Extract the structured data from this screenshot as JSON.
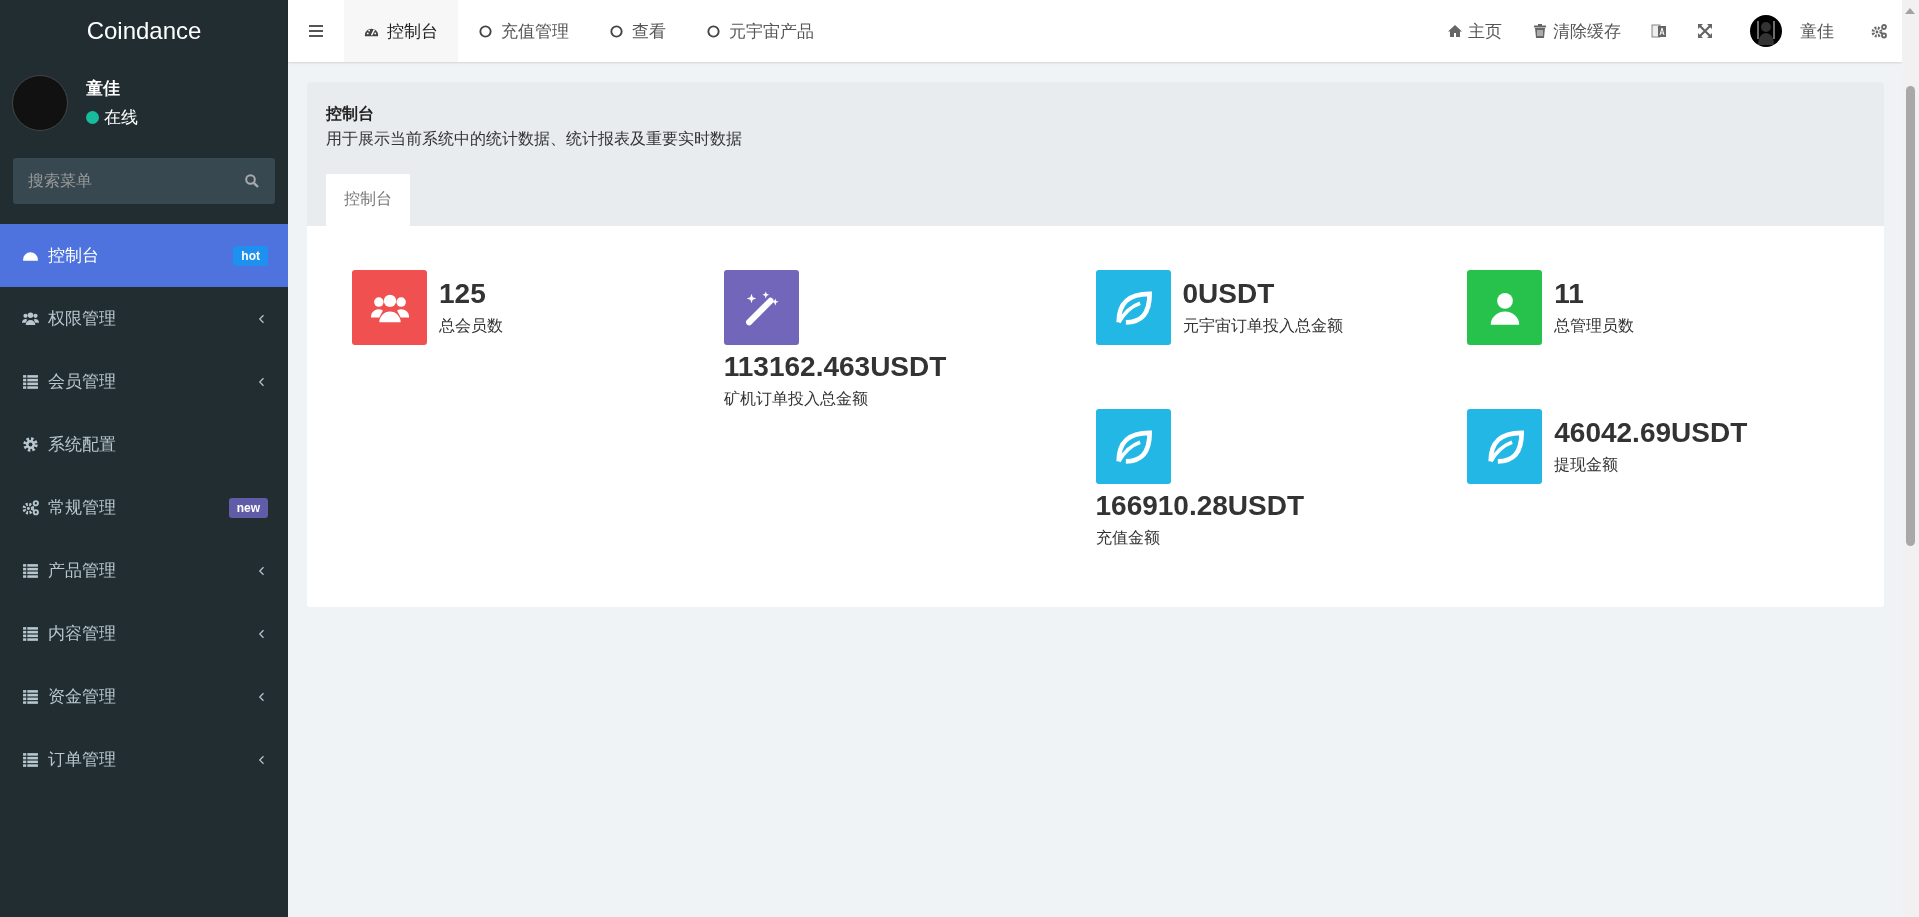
{
  "sidebar": {
    "brand": "Coindance",
    "user": {
      "name": "童佳",
      "status": "在线",
      "online": true
    },
    "search": {
      "placeholder": "搜索菜单"
    },
    "items": [
      {
        "kind": "dashboard",
        "label": "控制台",
        "selected": true,
        "badge": {
          "text": "hot",
          "color": "#1e90ef"
        }
      },
      {
        "kind": "users",
        "label": "权限管理",
        "selected": false,
        "expanded": false
      },
      {
        "kind": "list",
        "label": "会员管理",
        "selected": false,
        "expanded": false
      },
      {
        "kind": "gear",
        "label": "系统配置",
        "selected": false
      },
      {
        "kind": "gears",
        "label": "常规管理",
        "selected": false,
        "badge": {
          "text": "new",
          "color": "#605ca8"
        }
      },
      {
        "kind": "list",
        "label": "产品管理",
        "selected": false,
        "expanded": false
      },
      {
        "kind": "list",
        "label": "内容管理",
        "selected": false,
        "expanded": false
      },
      {
        "kind": "list",
        "label": "资金管理",
        "selected": false,
        "expanded": false
      },
      {
        "kind": "list",
        "label": "订单管理",
        "selected": false,
        "expanded": false
      }
    ]
  },
  "topbar": {
    "tabs": [
      {
        "kind": "dashboard",
        "label": "控制台",
        "selected": true
      },
      {
        "kind": "circle",
        "label": "充值管理",
        "selected": false
      },
      {
        "kind": "circle",
        "label": "查看",
        "selected": false
      },
      {
        "kind": "circle",
        "label": "元宇宙产品",
        "selected": false
      }
    ],
    "right": [
      {
        "kind": "home",
        "label": "主页"
      },
      {
        "kind": "trash",
        "label": "清除缓存"
      },
      {
        "kind": "translate"
      },
      {
        "kind": "fullscreen"
      },
      {
        "kind": "avatar",
        "label": "童佳"
      },
      {
        "kind": "gears"
      }
    ]
  },
  "panel": {
    "title": "控制台",
    "description": "用于展示当前系统中的统计数据、统计报表及重要实时数据",
    "tabs": [
      {
        "label": "控制台",
        "selected": true
      }
    ],
    "stats": [
      {
        "kind": "users",
        "color": "#f05050",
        "value": "125",
        "label": "总会员数"
      },
      {
        "kind": "magic",
        "color": "#7266ba",
        "value": "113162.463USDT",
        "label": "矿机订单投入总金额"
      },
      {
        "kind": "leaf",
        "color": "#23b7e5",
        "value": "0USDT",
        "label": "元宇宙订单投入总金额"
      },
      {
        "kind": "user",
        "color": "#27c24c",
        "value": "11",
        "label": "总管理员数"
      },
      {
        "kind": "leaf",
        "color": "#23b7e5",
        "value": "166910.28USDT",
        "label": "充值金额"
      },
      {
        "kind": "leaf",
        "color": "#23b7e5",
        "value": "46042.69USDT",
        "label": "提现金额"
      }
    ]
  }
}
